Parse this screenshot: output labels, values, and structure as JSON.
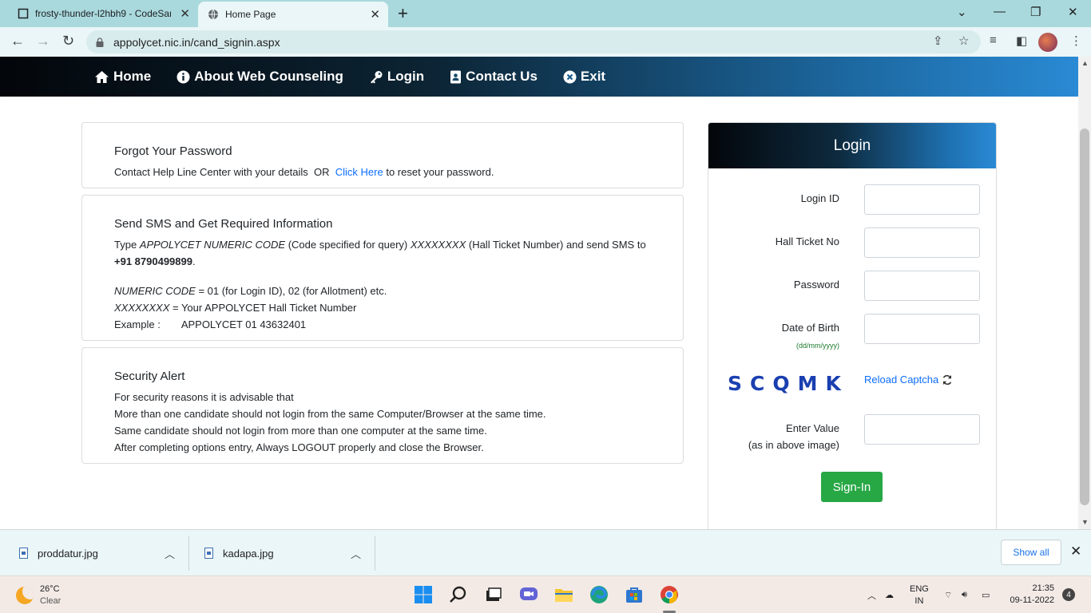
{
  "browser": {
    "tabs": [
      {
        "title": "frosty-thunder-l2hbh9 - CodeSan",
        "active": false
      },
      {
        "title": "Home Page",
        "active": true
      }
    ],
    "url": "appolycet.nic.in/cand_signin.aspx"
  },
  "nav": {
    "items": [
      "Home",
      "About Web Counseling",
      "Login",
      "Contact Us",
      "Exit"
    ]
  },
  "forgot": {
    "heading": "Forgot Your Password",
    "text_before": "Contact Help Line Center with your details  OR  ",
    "link": "Click Here",
    "text_after": " to reset your password."
  },
  "sms": {
    "heading": "Send SMS and Get Required Information",
    "line1_type": "Type ",
    "line1_code": "APPOLYCET NUMERIC CODE",
    "line1_mid": " (Code specified for query) ",
    "line1_x": "XXXXXXXX",
    "line1_end": " (Hall Ticket Number) and send SMS to ",
    "number": "+91 8790499899",
    "period": ".",
    "numeric_label": "NUMERIC CODE",
    "numeric_text": " = 01 (for Login ID), 02 (for Allotment) etc.",
    "x_label": "XXXXXXXX",
    "x_text": " = Your APPOLYCET Hall Ticket Number",
    "example_label": "Example :",
    "example_value": "APPOLYCET 01 43632401"
  },
  "security": {
    "heading": "Security Alert",
    "lines": [
      "For security reasons it is advisable that",
      "More than one candidate should not login from the same Computer/Browser at the same time.",
      "Same candidate should not login from more than one computer at the same time.",
      "After completing options entry, Always LOGOUT properly and close the Browser."
    ]
  },
  "login": {
    "title": "Login",
    "login_id_label": "Login ID",
    "hall_ticket_label": "Hall Ticket No",
    "password_label": "Password",
    "dob_label": "Date of Birth",
    "dob_hint": "(dd/mm/yyyy)",
    "captcha_text": "SCQMK",
    "reload_label": "Reload Captcha",
    "enter_value_label": "Enter Value",
    "enter_value_hint": "(as in above image)",
    "signin_label": "Sign-In"
  },
  "downloads": {
    "files": [
      "proddatur.jpg",
      "kadapa.jpg"
    ],
    "show_all": "Show all"
  },
  "taskbar": {
    "temp": "26°C",
    "weather": "Clear",
    "lang1": "ENG",
    "lang2": "IN",
    "time": "21:35",
    "date": "09-11-2022",
    "notifications": "4"
  }
}
